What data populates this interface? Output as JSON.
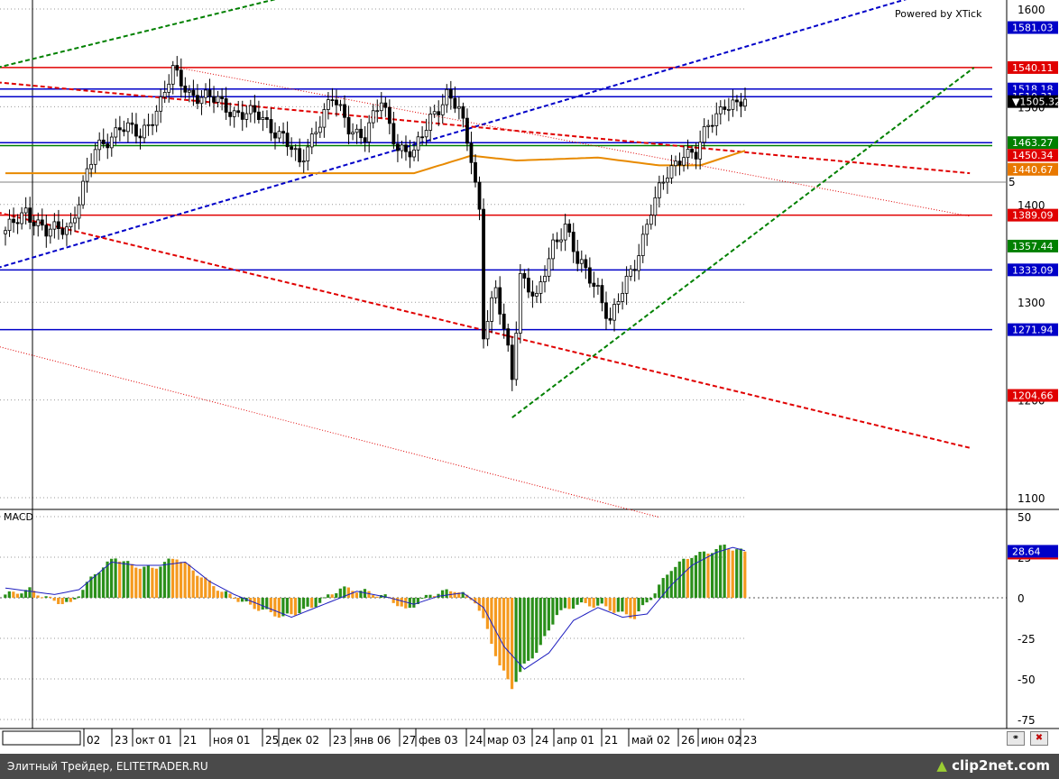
{
  "chart_data": [
    {
      "type": "candlestick",
      "panel": "price",
      "watermark": "Powered by XTick",
      "ylim": [
        1080,
        1610
      ],
      "yticks": [
        "1600",
        "1500",
        "1400",
        "1300",
        "1200",
        "1100"
      ],
      "partial_tick_label": "5",
      "x_labels": [
        "02",
        "23",
        "окт 01",
        "21",
        "ноя 01",
        "25",
        "дек 02",
        "23",
        "янв 06",
        "27",
        "фев 03",
        "24",
        "мар 03",
        "24",
        "апр 01",
        "21",
        "май 02",
        "26",
        "июн 02",
        "23"
      ],
      "close_anchors": [
        {
          "bar": 0,
          "value": 1370
        },
        {
          "bar": 5,
          "value": 1395
        },
        {
          "bar": 10,
          "value": 1370
        },
        {
          "bar": 16,
          "value": 1380
        },
        {
          "bar": 22,
          "value": 1455
        },
        {
          "bar": 28,
          "value": 1480
        },
        {
          "bar": 33,
          "value": 1470
        },
        {
          "bar": 38,
          "value": 1505
        },
        {
          "bar": 41,
          "value": 1535
        },
        {
          "bar": 45,
          "value": 1515
        },
        {
          "bar": 52,
          "value": 1505
        },
        {
          "bar": 56,
          "value": 1495
        },
        {
          "bar": 62,
          "value": 1490
        },
        {
          "bar": 68,
          "value": 1470
        },
        {
          "bar": 72,
          "value": 1440
        },
        {
          "bar": 76,
          "value": 1480
        },
        {
          "bar": 80,
          "value": 1508
        },
        {
          "bar": 84,
          "value": 1480
        },
        {
          "bar": 88,
          "value": 1470
        },
        {
          "bar": 92,
          "value": 1505
        },
        {
          "bar": 96,
          "value": 1460
        },
        {
          "bar": 100,
          "value": 1450
        },
        {
          "bar": 104,
          "value": 1490
        },
        {
          "bar": 108,
          "value": 1512
        },
        {
          "bar": 111,
          "value": 1495
        },
        {
          "bar": 114,
          "value": 1450
        },
        {
          "bar": 116,
          "value": 1395
        },
        {
          "bar": 117,
          "value": 1270
        },
        {
          "bar": 120,
          "value": 1310
        },
        {
          "bar": 123,
          "value": 1250
        },
        {
          "bar": 124,
          "value": 1225
        },
        {
          "bar": 126,
          "value": 1330
        },
        {
          "bar": 130,
          "value": 1300
        },
        {
          "bar": 134,
          "value": 1360
        },
        {
          "bar": 137,
          "value": 1380
        },
        {
          "bar": 140,
          "value": 1340
        },
        {
          "bar": 145,
          "value": 1315
        },
        {
          "bar": 148,
          "value": 1280
        },
        {
          "bar": 151,
          "value": 1310
        },
        {
          "bar": 154,
          "value": 1340
        },
        {
          "bar": 158,
          "value": 1395
        },
        {
          "bar": 162,
          "value": 1430
        },
        {
          "bar": 166,
          "value": 1455
        },
        {
          "bar": 169,
          "value": 1450
        },
        {
          "bar": 172,
          "value": 1480
        },
        {
          "bar": 176,
          "value": 1505
        },
        {
          "bar": 179,
          "value": 1500
        },
        {
          "bar": 181,
          "value": 1505
        }
      ],
      "moving_average": [
        {
          "bar": 0,
          "value": 1432
        },
        {
          "bar": 40,
          "value": 1432
        },
        {
          "bar": 100,
          "value": 1432
        },
        {
          "bar": 114,
          "value": 1450
        },
        {
          "bar": 125,
          "value": 1445
        },
        {
          "bar": 145,
          "value": 1448
        },
        {
          "bar": 160,
          "value": 1440
        },
        {
          "bar": 170,
          "value": 1440
        },
        {
          "bar": 181,
          "value": 1455
        }
      ],
      "horizontal_levels": [
        {
          "value": 1540.11,
          "color": "#e00000",
          "label": "1540.11"
        },
        {
          "value": 1518.18,
          "color": "#0000c8",
          "label": "1518.18"
        },
        {
          "value": 1510.31,
          "color": "#0000c8",
          "label": "1510.31"
        },
        {
          "value": 1463.27,
          "color": "#0000c8",
          "label": "1463.27"
        },
        {
          "value": 1460.2,
          "color": "#008000",
          "label": ""
        },
        {
          "value": 1389.09,
          "color": "#e00000",
          "label": "1389.09"
        },
        {
          "value": 1333.09,
          "color": "#0000c8",
          "label": "1333.09"
        },
        {
          "value": 1271.94,
          "color": "#0000c8",
          "label": "1271.94"
        }
      ],
      "price_badges": [
        {
          "value": 1581.03,
          "label": "1581.03",
          "color": "#0000c8"
        },
        {
          "value": 1540.11,
          "label": "1540.11",
          "color": "#e00000"
        },
        {
          "value": 1518.18,
          "label": "1518.18",
          "color": "#0000c8"
        },
        {
          "value": 1510.31,
          "label": "1510.31",
          "color": "#0000c8"
        },
        {
          "value": 1505.32,
          "label": "▼1505.32",
          "color": "#000000"
        },
        {
          "value": 1463.27,
          "label": "1463.27",
          "color": "#008000"
        },
        {
          "value": 1450.34,
          "label": "1450.34",
          "color": "#e00000"
        },
        {
          "value": 1436.0,
          "label": "1440.67",
          "color": "#e87800"
        },
        {
          "value": 1389.09,
          "label": "1389.09",
          "color": "#e00000"
        },
        {
          "value": 1357.44,
          "label": "1357.44",
          "color": "#008000"
        },
        {
          "value": 1333.09,
          "label": "1333.09",
          "color": "#0000c8"
        },
        {
          "value": 1271.94,
          "label": "1271.94",
          "color": "#0000c8"
        },
        {
          "value": 1204.66,
          "label": "1204.66",
          "color": "#e00000"
        }
      ],
      "trend_lines": [
        {
          "color": "#0000c8",
          "style": "dashed",
          "from": {
            "bar": -2,
            "value": 1335
          },
          "to": {
            "bar": 222,
            "value": 1612
          }
        },
        {
          "color": "#008000",
          "style": "dashed",
          "from": {
            "bar": -2,
            "value": 1540
          },
          "to": {
            "bar": 68,
            "value": 1612
          }
        },
        {
          "color": "#008000",
          "style": "dashed",
          "from": {
            "bar": 124,
            "value": 1182
          },
          "to": {
            "bar": 237,
            "value": 1540
          }
        },
        {
          "color": "#e00000",
          "style": "dashed",
          "from": {
            "bar": -2,
            "value": 1525
          },
          "to": {
            "bar": 236,
            "value": 1432
          }
        },
        {
          "color": "#e00000",
          "style": "dashed",
          "from": {
            "bar": -2,
            "value": 1392
          },
          "to": {
            "bar": 236,
            "value": 1151
          }
        },
        {
          "color": "#e00000",
          "style": "dotted",
          "from": {
            "bar": 41,
            "value": 1541
          },
          "to": {
            "bar": 236,
            "value": 1388
          }
        },
        {
          "color": "#e00000",
          "style": "dotted",
          "from": {
            "bar": -2,
            "value": 1255
          },
          "to": {
            "bar": 160,
            "value": 1080
          }
        }
      ]
    },
    {
      "type": "macd",
      "panel": "indicator",
      "title": "MACD",
      "ylim": [
        -80,
        60
      ],
      "yticks": [
        "50",
        "25",
        "0",
        "-25",
        "-50",
        "-75"
      ],
      "last_value_label": "28.64",
      "zero_level": 0,
      "histogram_anchors": [
        {
          "bar": 0,
          "value": 2
        },
        {
          "bar": 6,
          "value": 5
        },
        {
          "bar": 12,
          "value": -2
        },
        {
          "bar": 16,
          "value": -4
        },
        {
          "bar": 22,
          "value": 15
        },
        {
          "bar": 27,
          "value": 25
        },
        {
          "bar": 31,
          "value": 20
        },
        {
          "bar": 36,
          "value": 18
        },
        {
          "bar": 42,
          "value": 25
        },
        {
          "bar": 47,
          "value": 15
        },
        {
          "bar": 53,
          "value": 4
        },
        {
          "bar": 60,
          "value": -5
        },
        {
          "bar": 68,
          "value": -12
        },
        {
          "bar": 75,
          "value": -6
        },
        {
          "bar": 82,
          "value": 6
        },
        {
          "bar": 88,
          "value": 4
        },
        {
          "bar": 94,
          "value": 0
        },
        {
          "bar": 98,
          "value": -8
        },
        {
          "bar": 104,
          "value": 2
        },
        {
          "bar": 110,
          "value": 5
        },
        {
          "bar": 115,
          "value": -2
        },
        {
          "bar": 118,
          "value": -20
        },
        {
          "bar": 121,
          "value": -42
        },
        {
          "bar": 124,
          "value": -55
        },
        {
          "bar": 127,
          "value": -42
        },
        {
          "bar": 131,
          "value": -30
        },
        {
          "bar": 135,
          "value": -10
        },
        {
          "bar": 140,
          "value": -4
        },
        {
          "bar": 146,
          "value": -5
        },
        {
          "bar": 151,
          "value": -10
        },
        {
          "bar": 154,
          "value": -12
        },
        {
          "bar": 158,
          "value": 0
        },
        {
          "bar": 163,
          "value": 18
        },
        {
          "bar": 168,
          "value": 26
        },
        {
          "bar": 172,
          "value": 28
        },
        {
          "bar": 176,
          "value": 32
        },
        {
          "bar": 181,
          "value": 28
        }
      ],
      "signal_anchors": [
        {
          "bar": 0,
          "value": 6
        },
        {
          "bar": 12,
          "value": 2
        },
        {
          "bar": 18,
          "value": 5
        },
        {
          "bar": 26,
          "value": 22
        },
        {
          "bar": 32,
          "value": 20
        },
        {
          "bar": 38,
          "value": 20
        },
        {
          "bar": 44,
          "value": 22
        },
        {
          "bar": 50,
          "value": 10
        },
        {
          "bar": 56,
          "value": 2
        },
        {
          "bar": 62,
          "value": -4
        },
        {
          "bar": 70,
          "value": -12
        },
        {
          "bar": 78,
          "value": -4
        },
        {
          "bar": 86,
          "value": 4
        },
        {
          "bar": 94,
          "value": 0
        },
        {
          "bar": 100,
          "value": -4
        },
        {
          "bar": 106,
          "value": 1
        },
        {
          "bar": 112,
          "value": 3
        },
        {
          "bar": 117,
          "value": -6
        },
        {
          "bar": 122,
          "value": -30
        },
        {
          "bar": 127,
          "value": -44
        },
        {
          "bar": 133,
          "value": -34
        },
        {
          "bar": 139,
          "value": -14
        },
        {
          "bar": 145,
          "value": -6
        },
        {
          "bar": 151,
          "value": -12
        },
        {
          "bar": 157,
          "value": -10
        },
        {
          "bar": 163,
          "value": 8
        },
        {
          "bar": 168,
          "value": 20
        },
        {
          "bar": 174,
          "value": 28
        },
        {
          "bar": 178,
          "value": 31
        },
        {
          "bar": 181,
          "value": 29
        }
      ],
      "colors": {
        "up": "#2a8f1a",
        "down": "#f59a1f",
        "signal": "#2020c0",
        "zero": "#555555"
      }
    }
  ],
  "footer": {
    "left": "Элитный Трейдер, ELITETRADER.RU",
    "logo_main": "clip2net",
    "logo_tld": ".com"
  },
  "buttons": {
    "left_icon": "chain-icon",
    "right_icon": "close-icon"
  }
}
